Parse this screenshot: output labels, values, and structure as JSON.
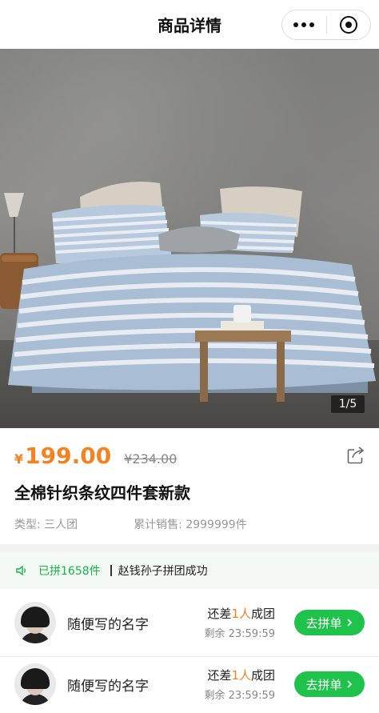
{
  "navbar": {
    "title": "商品详情"
  },
  "gallery": {
    "indicator": "1/5"
  },
  "product": {
    "currency": "¥",
    "price": "199.00",
    "original_price": "¥234.00",
    "title": "全棉针织条纹四件套新款",
    "type_label": "类型: 三人团",
    "sales_label": "累计销售: 2999999件"
  },
  "notice": {
    "count_text": "已拼1658件",
    "message": "赵钱孙子拼团成功"
  },
  "groups": [
    {
      "name": "随便写的名字",
      "status_prefix": "还差",
      "status_count": "1人",
      "status_suffix": "成团",
      "remaining": "剩余 23:59:59",
      "button": "去拼单"
    },
    {
      "name": "随便写的名字",
      "status_prefix": "还差",
      "status_count": "1人",
      "status_suffix": "成团",
      "remaining": "剩余 23:59:59",
      "button": "去拼单"
    }
  ],
  "colors": {
    "accent": "#f5821f",
    "primary_green": "#1fc24a",
    "notice_bg": "#f3faf3"
  }
}
